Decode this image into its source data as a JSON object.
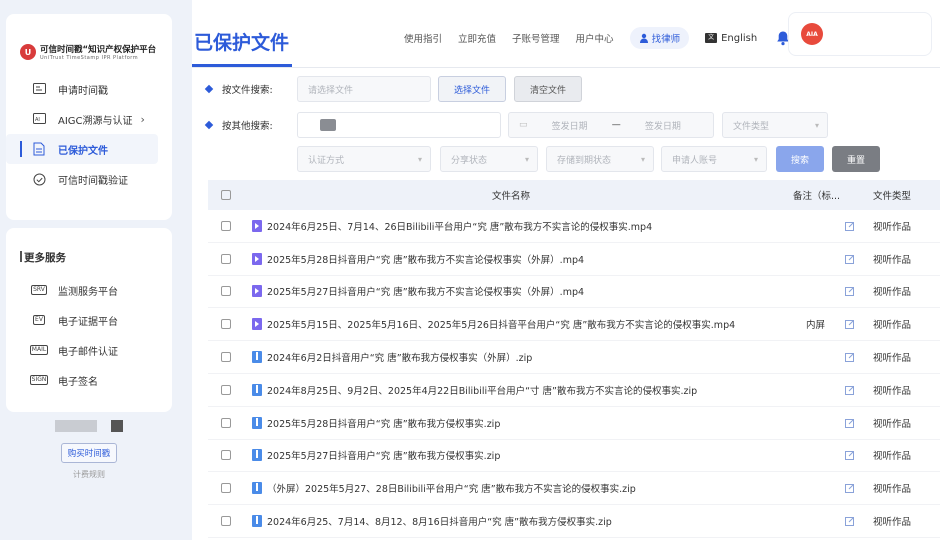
{
  "sidebar": {
    "logo_badge": "U",
    "logo_cn": "可信时间戳“知识产权保护平台",
    "logo_en": "UniTrust TimeStamp IPR Platform",
    "items": [
      {
        "label": "申请时间戳",
        "icon": "clock-window-icon"
      },
      {
        "label": "AIGC溯源与认证",
        "icon": "aigc-icon",
        "chevron": "›"
      },
      {
        "label": "已保护文件",
        "icon": "document-icon",
        "active": true
      },
      {
        "label": "可信时间戳验证",
        "icon": "check-circle-icon"
      }
    ],
    "more_title": "更多服务",
    "more_items": [
      {
        "label": "监测服务平台",
        "tag": "SRV",
        "icon": "monitor-icon"
      },
      {
        "label": "电子证据平台",
        "tag": "EV",
        "icon": "evidence-icon"
      },
      {
        "label": "电子邮件认证",
        "tag": "MAIL",
        "icon": "mail-icon"
      },
      {
        "label": "电子签名",
        "tag": "SIGN",
        "icon": "signature-icon"
      }
    ],
    "buy_label": "购买时间戳",
    "pricing_label": "计费规则"
  },
  "header": {
    "title": "已保护文件",
    "links": [
      "使用指引",
      "立即充值",
      "子账号管理",
      "用户中心"
    ],
    "lawyer_label": "找律师",
    "language": "English",
    "avatar_text": "AIA"
  },
  "filters": {
    "file_search_label": "按文件搜索:",
    "file_placeholder": "请选择文件",
    "choose_file": "选择文件",
    "clear_file": "清空文件",
    "other_search_label": "按其他搜索:",
    "start_date": "签发日期",
    "date_sep": "—",
    "end_date": "签发日期",
    "file_type": "文件类型",
    "auth_method": "认证方式",
    "share_status": "分享状态",
    "storage_status": "存储到期状态",
    "applicant": "申请人账号",
    "search_btn": "搜索",
    "reset_btn": "重置"
  },
  "table": {
    "columns": [
      "文件名称",
      "备注（标...",
      "文件类型"
    ],
    "rows": [
      {
        "name": "2024年6月25日、7月14、26日Bilibili平台用户“究          唐”散布我方不实言论的侵权事实.mp4",
        "kind": "video",
        "note": "",
        "type": "视听作品"
      },
      {
        "name": "2025年5月28日抖音用户“究          唐”散布我方不实言论侵权事实（外屏）.mp4",
        "kind": "video",
        "note": "",
        "type": "视听作品"
      },
      {
        "name": "2025年5月27日抖音用户“究          唐”散布我方不实言论侵权事实（外屏）.mp4",
        "kind": "video",
        "note": "",
        "type": "视听作品"
      },
      {
        "name": "2025年5月15日、2025年5月16日、2025年5月26日抖音平台用户“究          唐”散布我方不实言论的侵权事实.mp4",
        "kind": "video",
        "note": "内屏",
        "type": "视听作品"
      },
      {
        "name": "2024年6月2日抖音用户“究          唐”散布我方侵权事实（外屏）.zip",
        "kind": "zip",
        "note": "",
        "type": "视听作品"
      },
      {
        "name": "2024年8月25日、9月2日、2025年4月22日Bilibili平台用户“寸          唐”散布我方不实言论的侵权事实.zip",
        "kind": "zip",
        "note": "",
        "type": "视听作品"
      },
      {
        "name": "2025年5月28日抖音用户“究          唐”散布我方侵权事实.zip",
        "kind": "zip",
        "note": "",
        "type": "视听作品"
      },
      {
        "name": "2025年5月27日抖音用户“究          唐”散布我方侵权事实.zip",
        "kind": "zip",
        "note": "",
        "type": "视听作品"
      },
      {
        "name": "（外屏）2025年5月27、28日Bilibili平台用户“究          唐”散布我方不实言论的侵权事实.zip",
        "kind": "zip",
        "note": "",
        "type": "视听作品"
      },
      {
        "name": "2024年6月25、7月14、8月12、8月16日抖音用户“究          唐”散布我方侵权事实.zip",
        "kind": "zip",
        "note": "",
        "type": "视听作品"
      }
    ]
  },
  "colors": {
    "accent": "#2d5bd9",
    "background": "#eef2f9"
  }
}
